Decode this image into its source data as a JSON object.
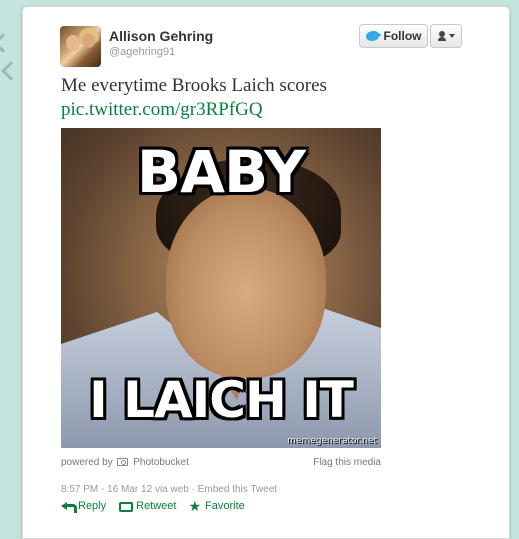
{
  "user": {
    "name": "Allison Gehring",
    "handle": "@agehring91"
  },
  "buttons": {
    "follow_label": "Follow",
    "follow_icon": "twitter-bird-icon",
    "user_menu_icon": "user-dropdown-icon"
  },
  "tweet": {
    "text": "Me everytime Brooks Laich scores",
    "link": "pic.twitter.com/gr3RPfGQ"
  },
  "media": {
    "meme_top": "BABY",
    "meme_bottom": "I LAICH IT",
    "watermark": "memegenerator.net",
    "powered_by_prefix": "powered by",
    "powered_by_name": "Photobucket",
    "flag_label": "Flag this media"
  },
  "meta": {
    "timestamp": "8:57 PM - 16 Mar 12",
    "via": "via web",
    "embed": "Embed this Tweet"
  },
  "actions": {
    "reply": "Reply",
    "retweet": "Retweet",
    "favorite": "Favorite"
  },
  "colors": {
    "background": "#c5e3df",
    "link_green": "#0a7f3e",
    "twitter_blue": "#33aaf0"
  }
}
